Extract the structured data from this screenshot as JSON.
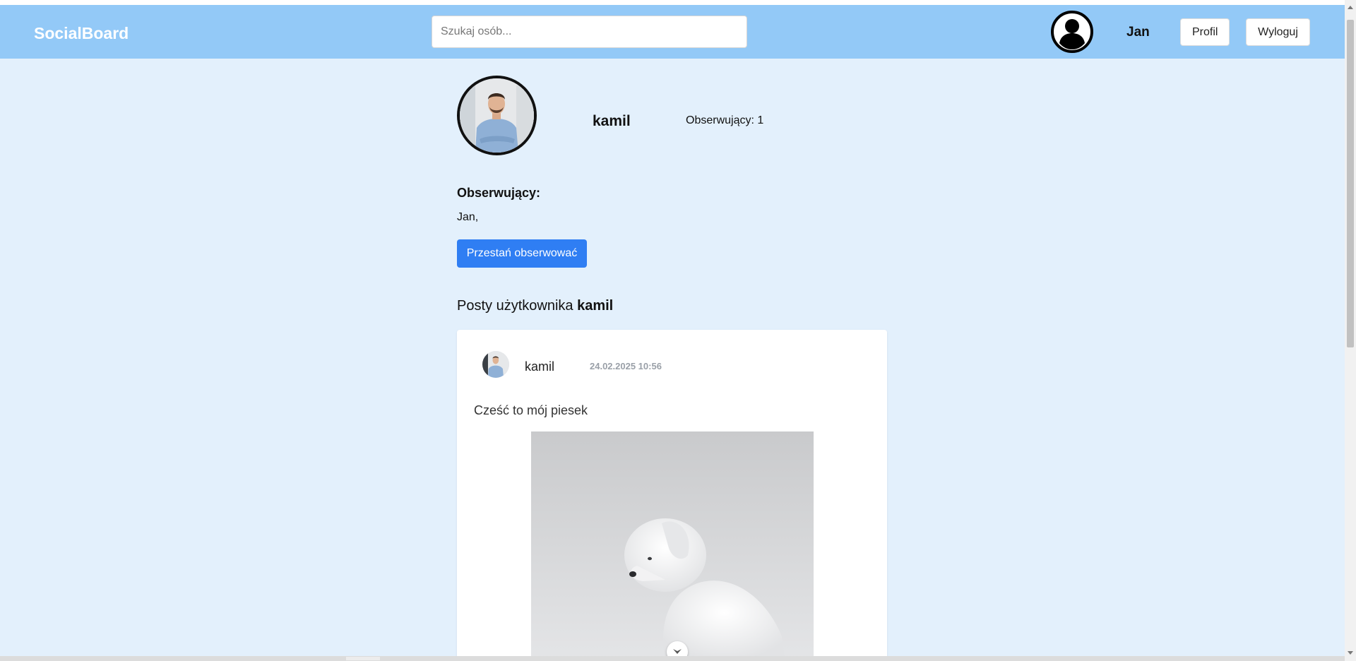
{
  "navbar": {
    "brand": "SocialBoard",
    "search_placeholder": "Szukaj osób...",
    "avatar_icon": "user-circle-icon",
    "username": "Jan",
    "profile_label": "Profil",
    "logout_label": "Wyloguj"
  },
  "profile": {
    "name": "kamil",
    "followers_count_text": "Obserwujący: 1",
    "followers_title": "Obserwujący:",
    "followers_list": "Jan,",
    "unfollow_label": "Przestań obserwować",
    "posts_heading_prefix": "Posty użytkownika",
    "posts_heading_user": "kamil"
  },
  "post": {
    "author": "kamil",
    "date": "24.02.2025 10:56",
    "text": "Cześć to mój piesek"
  },
  "colors": {
    "navbar": "#93c9f7",
    "background": "#e3f0fc",
    "primary_button": "#2f7ef3"
  }
}
